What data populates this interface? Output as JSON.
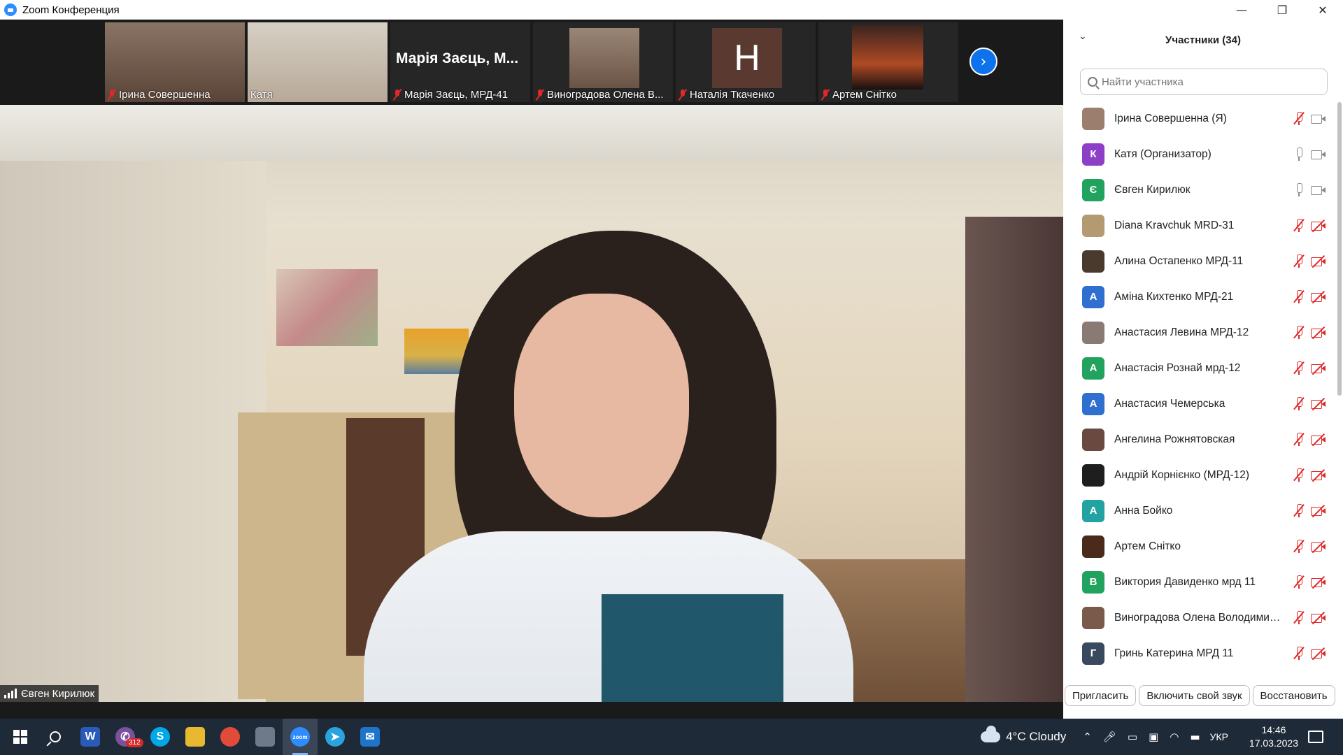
{
  "window": {
    "title": "Zoom Конференция",
    "minimize": "—",
    "restore": "❐",
    "close": "✕"
  },
  "thumbnails": [
    {
      "name": "Ірина Совершенна",
      "muted": true,
      "type": "video",
      "bg": "#7a6a5c"
    },
    {
      "name": "Катя",
      "muted": false,
      "type": "video",
      "bg": "#c7bfb0"
    },
    {
      "name": "Марія Заєць, МРД-41",
      "display_big": "Марія Заєць, М...",
      "muted": true,
      "type": "name"
    },
    {
      "name": "Виноградова Олена В...",
      "muted": true,
      "type": "video",
      "bg": "#8c7462"
    },
    {
      "name": "Наталія Ткаченко",
      "initial": "Н",
      "muted": true,
      "type": "initial"
    },
    {
      "name": "Артем Снітко",
      "muted": true,
      "type": "video",
      "bg": "#2a1c18"
    }
  ],
  "next_button": "›",
  "main_speaker": {
    "name": "Євген Кирилюк"
  },
  "participants_panel": {
    "title": "Участники (34)",
    "search_placeholder": "Найти участника",
    "participants": [
      {
        "name": "Ірина Совершенна (Я)",
        "avatar": "",
        "color": "#9c7e6e",
        "mic_off": true,
        "cam_off": false
      },
      {
        "name": "Катя (Организатор)",
        "avatar": "К",
        "color": "#8e3fc7",
        "mic_off": false,
        "cam_off": false
      },
      {
        "name": "Євген Кирилюк",
        "avatar": "Є",
        "color": "#22a25f",
        "mic_off": false,
        "cam_off": false
      },
      {
        "name": "Diana Kravchuk MRD-31",
        "avatar": "",
        "color": "#b49a70",
        "mic_off": true,
        "cam_off": true
      },
      {
        "name": "Алина Остапенко МРД-11",
        "avatar": "",
        "color": "#4a3a2e",
        "mic_off": true,
        "cam_off": true
      },
      {
        "name": "Аміна Кихтенко МРД-21",
        "avatar": "А",
        "color": "#2f6fd0",
        "mic_off": true,
        "cam_off": true
      },
      {
        "name": "Анастасия Левина МРД-12",
        "avatar": "",
        "color": "#8a7a74",
        "mic_off": true,
        "cam_off": true
      },
      {
        "name": "Анастасія Рознай мрд-12",
        "avatar": "А",
        "color": "#22a25f",
        "mic_off": true,
        "cam_off": true
      },
      {
        "name": "Анастасия Чемерська",
        "avatar": "А",
        "color": "#2f6fd0",
        "mic_off": true,
        "cam_off": true
      },
      {
        "name": "Ангелина Рожнятовская",
        "avatar": "",
        "color": "#6a4a40",
        "mic_off": true,
        "cam_off": true
      },
      {
        "name": "Андрій Корнієнко (МРД-12)",
        "avatar": "",
        "color": "#1e1e1e",
        "mic_off": true,
        "cam_off": true
      },
      {
        "name": "Анна Бойко",
        "avatar": "А",
        "color": "#22a2a0",
        "mic_off": true,
        "cam_off": true
      },
      {
        "name": "Артем Снітко",
        "avatar": "",
        "color": "#4a2a1a",
        "mic_off": true,
        "cam_off": true
      },
      {
        "name": "Виктория Давиденко мрд 11",
        "avatar": "В",
        "color": "#22a25f",
        "mic_off": true,
        "cam_off": true
      },
      {
        "name": "Виноградова Олена Володимир...",
        "avatar": "",
        "color": "#7a5a4a",
        "mic_off": true,
        "cam_off": true
      },
      {
        "name": "Гринь Катерина МРД 11",
        "avatar": "Г",
        "color": "#3a4a5e",
        "mic_off": true,
        "cam_off": true
      }
    ],
    "buttons": {
      "invite": "Пригласить",
      "unmute": "Включить свой звук",
      "restore": "Восстановить"
    }
  },
  "taskbar": {
    "apps": [
      {
        "name": "windows-start",
        "active": false
      },
      {
        "name": "search",
        "active": false
      },
      {
        "name": "word",
        "label": "W",
        "color": "#2b5bb8",
        "active": false
      },
      {
        "name": "viber",
        "label": "✆",
        "color": "#7b519d",
        "badge": "312",
        "active": false
      },
      {
        "name": "skype",
        "label": "S",
        "color": "#00a8e8",
        "active": false
      },
      {
        "name": "file-explorer",
        "label": "",
        "color": "#e8b830",
        "active": false
      },
      {
        "name": "chrome",
        "label": "",
        "color": "#e24a3a",
        "active": false
      },
      {
        "name": "microsoft-store",
        "label": "",
        "color": "#6e7a8a",
        "active": false
      },
      {
        "name": "zoom",
        "label": "zoom",
        "color": "#2d8cff",
        "active": true
      },
      {
        "name": "telegram",
        "label": "➤",
        "color": "#2aa3df",
        "active": false
      },
      {
        "name": "mail",
        "label": "✉",
        "color": "#1d74c9",
        "active": false
      }
    ],
    "weather": "4°C  Cloudy",
    "language": "УКР",
    "time": "14:46",
    "date": "17.03.2023"
  }
}
